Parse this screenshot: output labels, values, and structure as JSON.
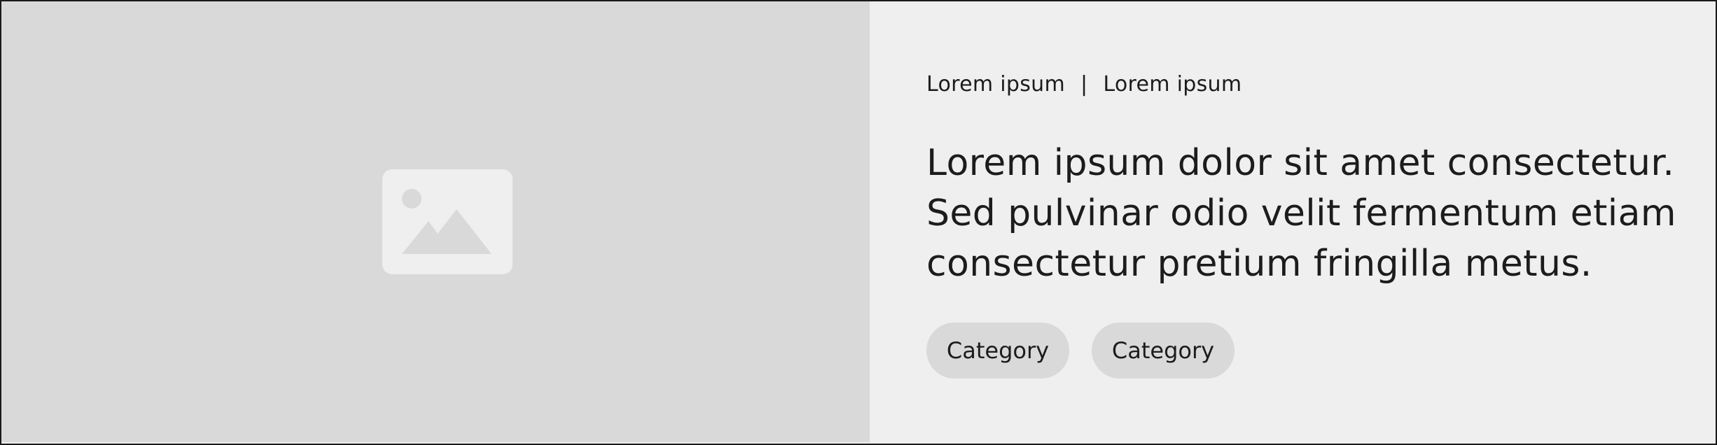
{
  "meta": {
    "left": "Lorem ipsum",
    "separator": "|",
    "right": "Lorem ipsum"
  },
  "headline": "Lorem ipsum dolor sit amet consectetur. Sed pulvinar odio velit fermentum etiam consectetur pretium fringilla metus.",
  "tags": [
    {
      "label": "Category"
    },
    {
      "label": "Category"
    }
  ],
  "media": {
    "icon": "image-placeholder-icon"
  },
  "colors": {
    "media_background": "#d9d9d9",
    "content_background": "#efefef",
    "tag_background": "#d9d9d9",
    "text": "#1c1c1c",
    "border": "#1a1a1a"
  }
}
